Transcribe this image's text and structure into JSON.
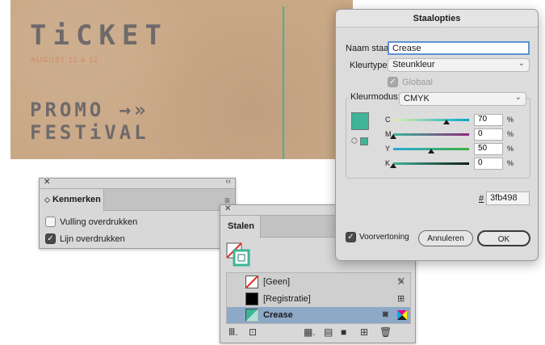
{
  "artwork": {
    "ticket": "TiCKET",
    "date": "AUGUST 11 & 12",
    "promo": "PROMO",
    "festival": "FESTiVAL"
  },
  "kenmerken": {
    "tab": "Kenmerken",
    "fill_overprint": {
      "label": "Vulling overdrukken",
      "checked": false
    },
    "stroke_overprint": {
      "label": "Lijn overdrukken",
      "checked": true
    }
  },
  "stalen": {
    "tab": "Stalen",
    "swatches": [
      {
        "name": "[Geen]",
        "selected": false
      },
      {
        "name": "[Registratie]",
        "selected": false
      },
      {
        "name": "Crease",
        "selected": true
      }
    ]
  },
  "dialog": {
    "title": "Staalopties",
    "name_label": "Naam staal:",
    "name_value": "Crease",
    "colortype_label": "Kleurtype:",
    "colortype_value": "Steunkleur",
    "global_label": "Globaal",
    "colormode_label": "Kleurmodus:",
    "colormode_value": "CMYK",
    "channels": [
      {
        "letter": "C",
        "value": "70",
        "pct": "%"
      },
      {
        "letter": "M",
        "value": "0",
        "pct": "%"
      },
      {
        "letter": "Y",
        "value": "50",
        "pct": "%"
      },
      {
        "letter": "K",
        "value": "0",
        "pct": "%"
      }
    ],
    "hex_label": "#",
    "hex_value": "3fb498",
    "preview_label": "Voorvertoning",
    "cancel_label": "Annuleren",
    "ok_label": "OK"
  },
  "colors": {
    "swatch": "#3fb498",
    "cardboard": "#c9a886",
    "selection": "#8da9c7"
  }
}
